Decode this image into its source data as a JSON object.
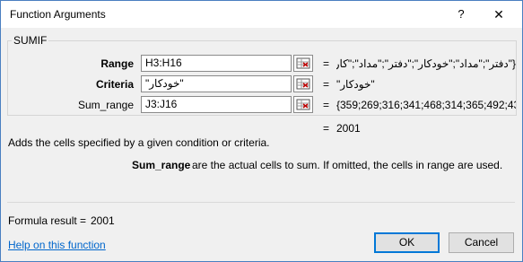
{
  "dialog": {
    "title": "Function Arguments",
    "help_label": "?",
    "close_label": "✕"
  },
  "function_name": "SUMIF",
  "arguments": [
    {
      "label": "Range",
      "value": "H3:H16",
      "equals": "=",
      "preview": "{\"دفتر\";\"مداد\";\"خودکار\";\"دفتر\";\"مداد\";\"کار"
    },
    {
      "label": "Criteria",
      "value": "\"خودکار\"",
      "equals": "=",
      "preview": "\"خودکار\""
    },
    {
      "label": "Sum_range",
      "value": "J3:J16",
      "equals": "=",
      "preview": "{359;269;316;341;468;314;365;492;43..."
    }
  ],
  "result_equals": "=",
  "result_value": "2001",
  "description": "Adds the cells specified by a given condition or criteria.",
  "arg_description": {
    "name": "Sum_range",
    "text": "are the actual cells to sum. If omitted, the cells in range are used."
  },
  "formula_result": {
    "label": "Formula result =",
    "value": "2001"
  },
  "help_link": "Help on this function",
  "buttons": {
    "ok": "OK",
    "cancel": "Cancel"
  },
  "icons": {
    "reference_collapse": "range-select-icon"
  }
}
